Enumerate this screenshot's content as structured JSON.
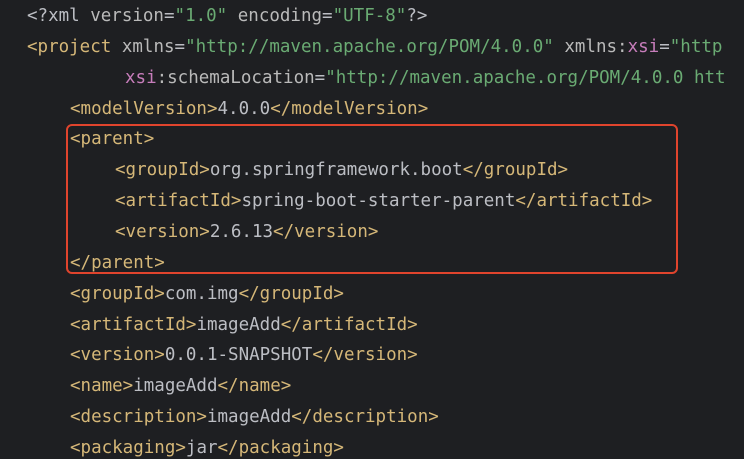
{
  "code": {
    "xml_decl": {
      "open": "<?xml ",
      "version_attr": "version",
      "eq1": "=",
      "version_val": "\"1.0\"",
      "encoding_attr": " encoding",
      "eq2": "=",
      "encoding_val": "\"UTF-8\"",
      "close": "?>"
    },
    "project": {
      "open": "<project",
      "xmlns_attr": " xmlns",
      "eq1": "=",
      "xmlns_val": "\"http://maven.apache.org/POM/4.0.0\"",
      "xmlns_xsi_attr": " xmlns:",
      "xsi_ns": "xsi",
      "eq2": "=",
      "xmlns_xsi_val": "\"http",
      "xsi_prefix": "xsi",
      "schema_attr": ":schemaLocation",
      "eq3": "=",
      "schema_val": "\"http://maven.apache.org/POM/4.0.0 htt"
    },
    "model_version": {
      "open": "<modelVersion>",
      "value": "4.0.0",
      "close": "</modelVersion>"
    },
    "parent_open": "<parent>",
    "parent_group_id": {
      "open": "<groupId>",
      "value": "org.springframework.boot",
      "close": "</groupId>"
    },
    "parent_artifact_id": {
      "open": "<artifactId>",
      "value": "spring-boot-starter-parent",
      "close": "</artifactId>"
    },
    "parent_version": {
      "open": "<version>",
      "value": "2.6.13",
      "close": "</version>"
    },
    "parent_close": "</parent>",
    "group_id": {
      "open": "<groupId>",
      "value": "com.img",
      "close": "</groupId>"
    },
    "artifact_id": {
      "open": "<artifactId>",
      "value": "imageAdd",
      "close": "</artifactId>"
    },
    "version": {
      "open": "<version>",
      "value": "0.0.1-SNAPSHOT",
      "close": "</version>"
    },
    "name": {
      "open": "<name>",
      "value": "imageAdd",
      "close": "</name>"
    },
    "description": {
      "open": "<description>",
      "value": "imageAdd",
      "close": "</description>"
    },
    "packaging": {
      "open": "<packaging>",
      "value": "jar",
      "close": "</packaging>"
    }
  },
  "colors": {
    "background": "#1e1f22",
    "tag": "#d5b778",
    "attribute": "#bababa",
    "namespace": "#c77dbb",
    "string": "#6aab73",
    "text": "#bcbec4",
    "highlight_border": "#e0442d"
  }
}
